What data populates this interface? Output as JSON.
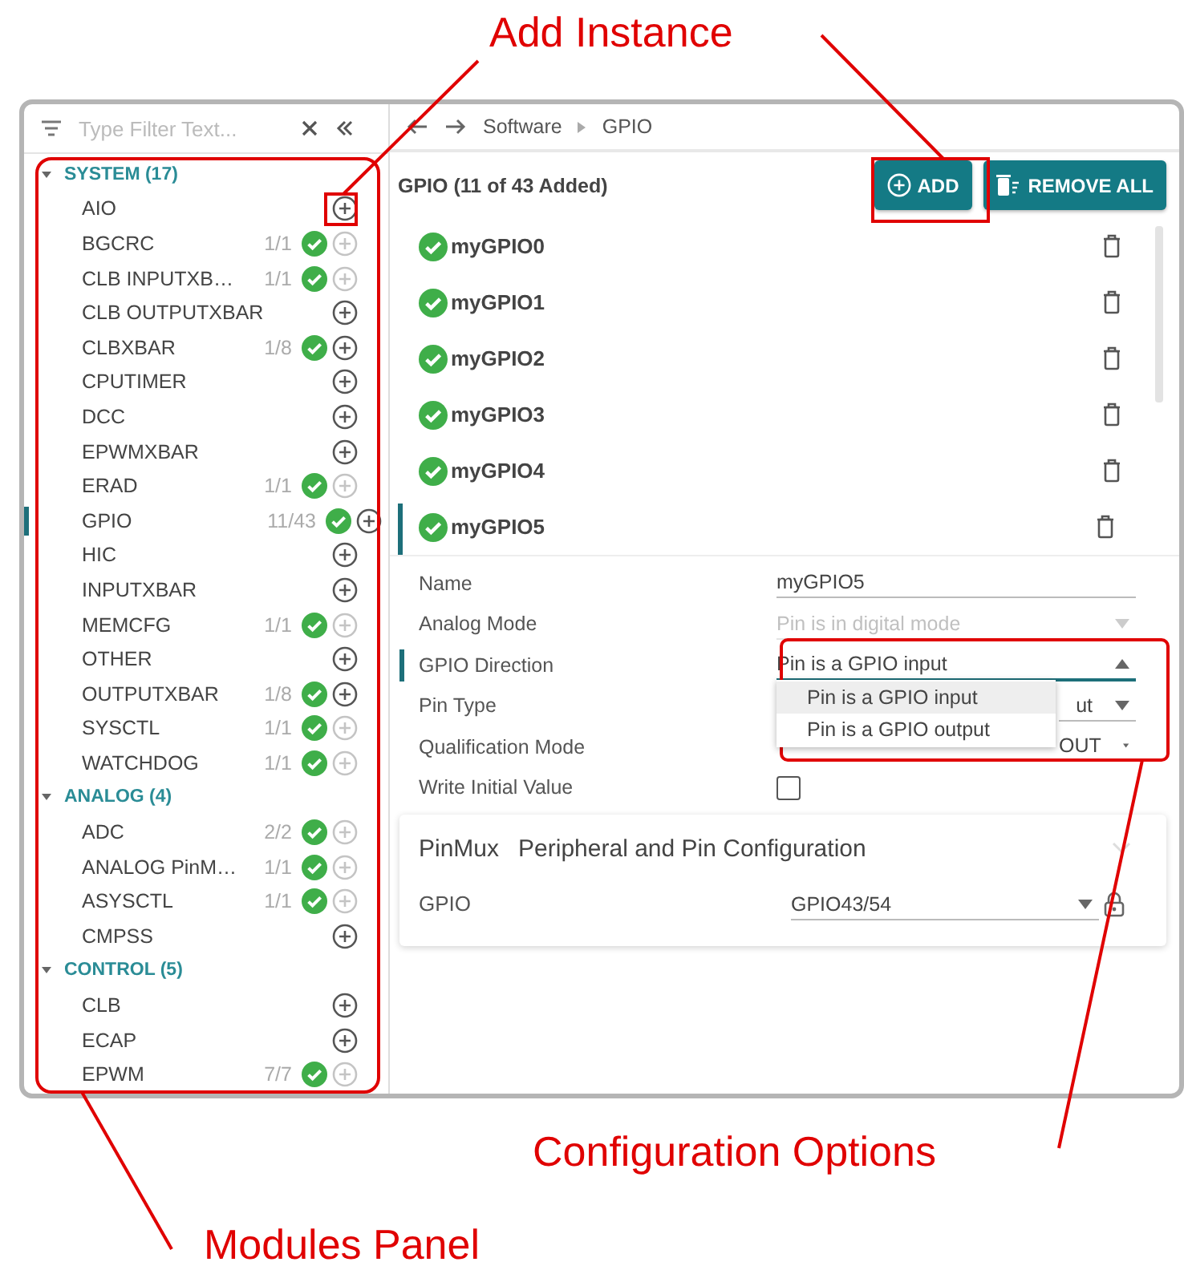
{
  "annotations": [
    {
      "text": "Add Instance"
    },
    {
      "text": "Configuration Options"
    },
    {
      "text": "Modules Panel"
    }
  ],
  "filter": {
    "placeholder": "Type Filter Text..."
  },
  "breadcrumb": [
    "Software",
    "GPIO"
  ],
  "modules": [
    {
      "category": "SYSTEM (17)",
      "expanded": true,
      "items": [
        {
          "name": "AIO",
          "added": false,
          "can_add": true,
          "selected": false
        },
        {
          "name": "BGCRC",
          "count": "1/1",
          "added": true,
          "can_add": false,
          "selected": false
        },
        {
          "name": "CLB INPUTXB…",
          "count": "1/1",
          "added": true,
          "can_add": false,
          "selected": false
        },
        {
          "name": "CLB OUTPUTXBAR",
          "added": false,
          "can_add": true,
          "selected": false
        },
        {
          "name": "CLBXBAR",
          "count": "1/8",
          "added": true,
          "can_add": true,
          "selected": false
        },
        {
          "name": "CPUTIMER",
          "added": false,
          "can_add": true,
          "selected": false
        },
        {
          "name": "DCC",
          "added": false,
          "can_add": true,
          "selected": false
        },
        {
          "name": "EPWMXBAR",
          "added": false,
          "can_add": true,
          "selected": false
        },
        {
          "name": "ERAD",
          "count": "1/1",
          "added": true,
          "can_add": false,
          "selected": false
        },
        {
          "name": "GPIO",
          "count": "11/43",
          "added": true,
          "can_add": true,
          "selected": true
        },
        {
          "name": "HIC",
          "added": false,
          "can_add": true,
          "selected": false
        },
        {
          "name": "INPUTXBAR",
          "added": false,
          "can_add": true,
          "selected": false
        },
        {
          "name": "MEMCFG",
          "count": "1/1",
          "added": true,
          "can_add": false,
          "selected": false
        },
        {
          "name": "OTHER",
          "added": false,
          "can_add": true,
          "selected": false
        },
        {
          "name": "OUTPUTXBAR",
          "count": "1/8",
          "added": true,
          "can_add": true,
          "selected": false
        },
        {
          "name": "SYSCTL",
          "count": "1/1",
          "added": true,
          "can_add": false,
          "selected": false
        },
        {
          "name": "WATCHDOG",
          "count": "1/1",
          "added": true,
          "can_add": false,
          "selected": false
        }
      ]
    },
    {
      "category": "ANALOG (4)",
      "expanded": true,
      "items": [
        {
          "name": "ADC",
          "count": "2/2",
          "added": true,
          "can_add": false,
          "selected": false
        },
        {
          "name": "ANALOG PinM…",
          "count": "1/1",
          "added": true,
          "can_add": false,
          "selected": false
        },
        {
          "name": "ASYSCTL",
          "count": "1/1",
          "added": true,
          "can_add": false,
          "selected": false
        },
        {
          "name": "CMPSS",
          "added": false,
          "can_add": true,
          "selected": false
        }
      ]
    },
    {
      "category": "CONTROL (5)",
      "expanded": true,
      "items": [
        {
          "name": "CLB",
          "added": false,
          "can_add": true,
          "selected": false
        },
        {
          "name": "ECAP",
          "added": false,
          "can_add": true,
          "selected": false
        },
        {
          "name": "EPWM",
          "count": "7/7",
          "added": true,
          "can_add": false,
          "selected": false
        }
      ]
    }
  ],
  "header": {
    "title": "GPIO (11 of 43 Added)",
    "add_button": "ADD",
    "remove_button": "REMOVE ALL"
  },
  "instances": [
    {
      "name": "myGPIO0",
      "selected": false
    },
    {
      "name": "myGPIO1",
      "selected": false
    },
    {
      "name": "myGPIO2",
      "selected": false
    },
    {
      "name": "myGPIO3",
      "selected": false
    },
    {
      "name": "myGPIO4",
      "selected": false
    },
    {
      "name": "myGPIO5",
      "selected": true
    }
  ],
  "fields": [
    {
      "kind": "text",
      "label": "Name",
      "value": "myGPIO5",
      "focused": false
    },
    {
      "kind": "select",
      "label": "Analog Mode",
      "value": "Pin is in digital mode",
      "disabled": true,
      "focused": false
    },
    {
      "kind": "select",
      "label": "GPIO Direction",
      "value": "Pin is a GPIO input",
      "focused": true,
      "open": true,
      "options": [
        {
          "label": "Pin is a GPIO input",
          "selected": true
        },
        {
          "label": "Pin is a GPIO output",
          "selected": false
        }
      ]
    },
    {
      "kind": "select",
      "label": "Pin Type",
      "value": "ut",
      "partly_hidden": true,
      "focused": false
    },
    {
      "kind": "select",
      "label": "Qualification Mode",
      "value": "OUT",
      "partly_hidden": true,
      "focused": false
    },
    {
      "kind": "checkbox",
      "label": "Write Initial Value",
      "checked": false,
      "focused": false
    }
  ],
  "pinmux": {
    "title": "PinMux",
    "subtitle": "Peripheral and Pin Configuration",
    "field_label": "GPIO",
    "field_value": "GPIO43/54",
    "locked": true
  }
}
